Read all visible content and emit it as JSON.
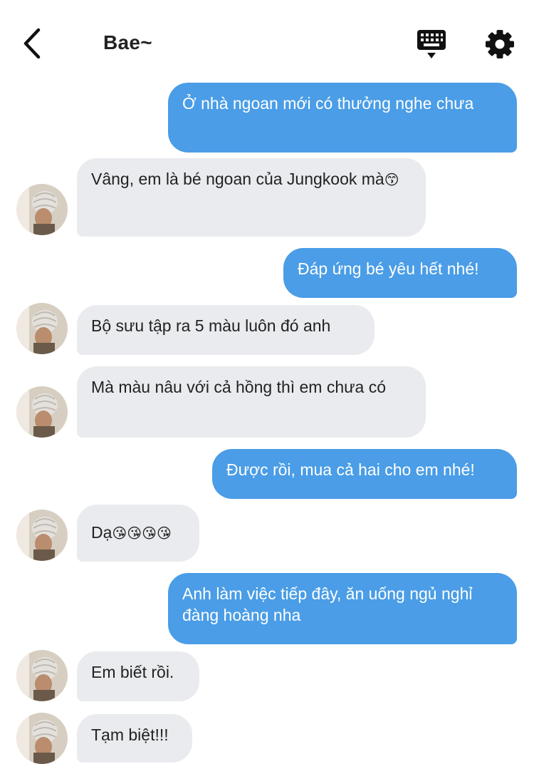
{
  "header": {
    "title": "Bae~",
    "back_icon": "chevron-left-icon",
    "keyboard_icon": "keyboard-icon",
    "settings_icon": "gear-icon"
  },
  "colors": {
    "sent_bubble": "#4a9de6",
    "received_bubble": "#e9ebee"
  },
  "messages": [
    {
      "from": "me",
      "text": "Ở nhà ngoan mới có thưởng nghe chưa"
    },
    {
      "from": "bae",
      "text": "Vâng, em là bé ngoan của Jungkook mà",
      "emoji": "😙"
    },
    {
      "from": "me",
      "text": "Đáp ứng bé yêu hết nhé!"
    },
    {
      "from": "bae",
      "text": "Bộ sưu tập ra 5 màu luôn đó anh"
    },
    {
      "from": "bae",
      "text": "Mà màu nâu với cả hồng thì em chưa có"
    },
    {
      "from": "me",
      "text": "Được rồi, mua cả hai cho em nhé!"
    },
    {
      "from": "bae",
      "text": "Dạ",
      "emoji": "😘😘😘😘"
    },
    {
      "from": "me",
      "text": "Anh làm việc tiếp đây, ăn uống ngủ nghỉ đàng hoàng nha"
    },
    {
      "from": "bae",
      "text": "Em biết rồi."
    },
    {
      "from": "bae",
      "text": "Tạm biệt!!!"
    }
  ]
}
